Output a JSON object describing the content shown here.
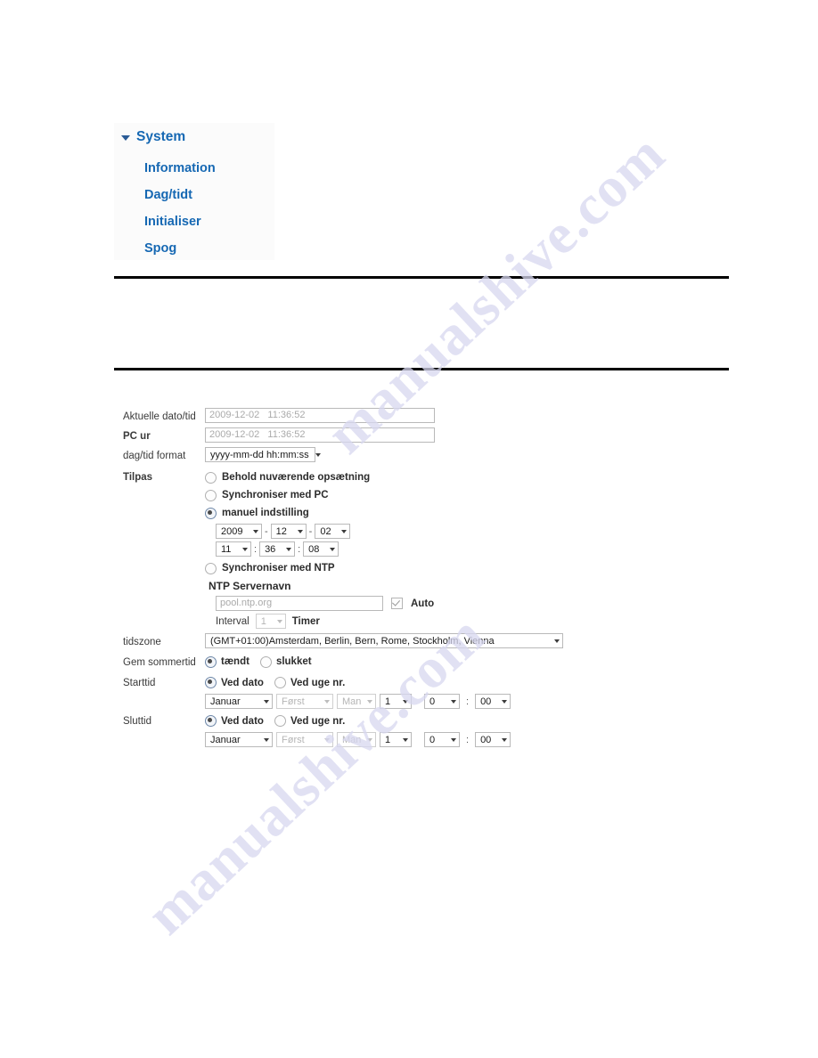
{
  "sidebar": {
    "root": {
      "label": "System",
      "caret": "caret-down-icon"
    },
    "items": [
      {
        "label": "Information"
      },
      {
        "label": "Dag/tidt"
      },
      {
        "label": "Initialiser"
      },
      {
        "label": "Spog"
      }
    ]
  },
  "watermark": {
    "line1": "manualshive.com",
    "line2": "manualshive.com"
  },
  "form": {
    "current_datetime": {
      "label": "Aktuelle dato/tid",
      "value": "2009-12-02   11:36:52"
    },
    "pc_clock": {
      "label": "PC ur",
      "value": "2009-12-02   11:36:52"
    },
    "datetime_format": {
      "label": "dag/tid format",
      "value": "yyyy-mm-dd hh:mm:ss"
    },
    "adjust": {
      "label": "Tilpas",
      "options": [
        {
          "label": "Behold nuværende opsætning",
          "selected": false
        },
        {
          "label": "Synchroniser med PC",
          "selected": false
        },
        {
          "label": "manuel indstilling",
          "selected": true
        },
        {
          "label": "Synchroniser med NTP",
          "selected": false
        }
      ],
      "manual": {
        "year": "2009",
        "month": "12",
        "day": "02",
        "hour": "11",
        "minute": "36",
        "second": "08",
        "date_sep": "-",
        "time_sep": ":"
      },
      "ntp": {
        "title": "NTP Servernavn",
        "server_placeholder": "pool.ntp.org",
        "auto_label": "Auto",
        "auto_checked": true,
        "interval_label": "Interval",
        "interval_value": "1",
        "hours_label": "Timer"
      }
    },
    "timezone": {
      "label": "tidszone",
      "value": "(GMT+01:00)Amsterdam, Berlin, Bern, Rome, Stockholm, Vienna"
    },
    "dst": {
      "label": "Gem sommertid",
      "on_label": "tændt",
      "off_label": "slukket",
      "on_selected": true
    },
    "start_time": {
      "label": "Starttid",
      "by_date_label": "Ved dato",
      "by_week_label": "Ved uge nr.",
      "by_date_selected": true,
      "month": "Januar",
      "ordinal": "Først",
      "weekday": "Man",
      "day": "1",
      "hour": "0",
      "minute": "00",
      "time_sep": ":"
    },
    "end_time": {
      "label": "Sluttid",
      "by_date_label": "Ved dato",
      "by_week_label": "Ved uge nr.",
      "by_date_selected": true,
      "month": "Januar",
      "ordinal": "Først",
      "weekday": "Man",
      "day": "1",
      "hour": "0",
      "minute": "00",
      "time_sep": ":"
    }
  }
}
